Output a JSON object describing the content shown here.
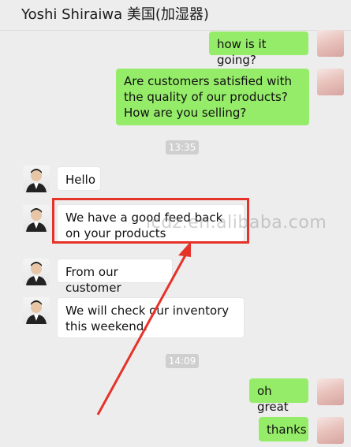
{
  "header": {
    "title": "Yoshi Shiraiwa 美国(加湿器)"
  },
  "messages": {
    "m1": "how is it going?",
    "m2": "Are customers satisfied with the quality of our products? How are you selling?",
    "t1": "13:35",
    "m3": "Hello",
    "m4": "We have a good feed back on your products",
    "m5": "From our customer",
    "m6": "We will check our inventory this weekend.",
    "t2": "14:09",
    "m7": "oh great",
    "m8": "thanks"
  },
  "watermark": "lcdz.en.alibaba.com",
  "colors": {
    "self_bubble": "#95ec69",
    "other_bubble": "#ffffff",
    "annotation": "#e5332a"
  }
}
